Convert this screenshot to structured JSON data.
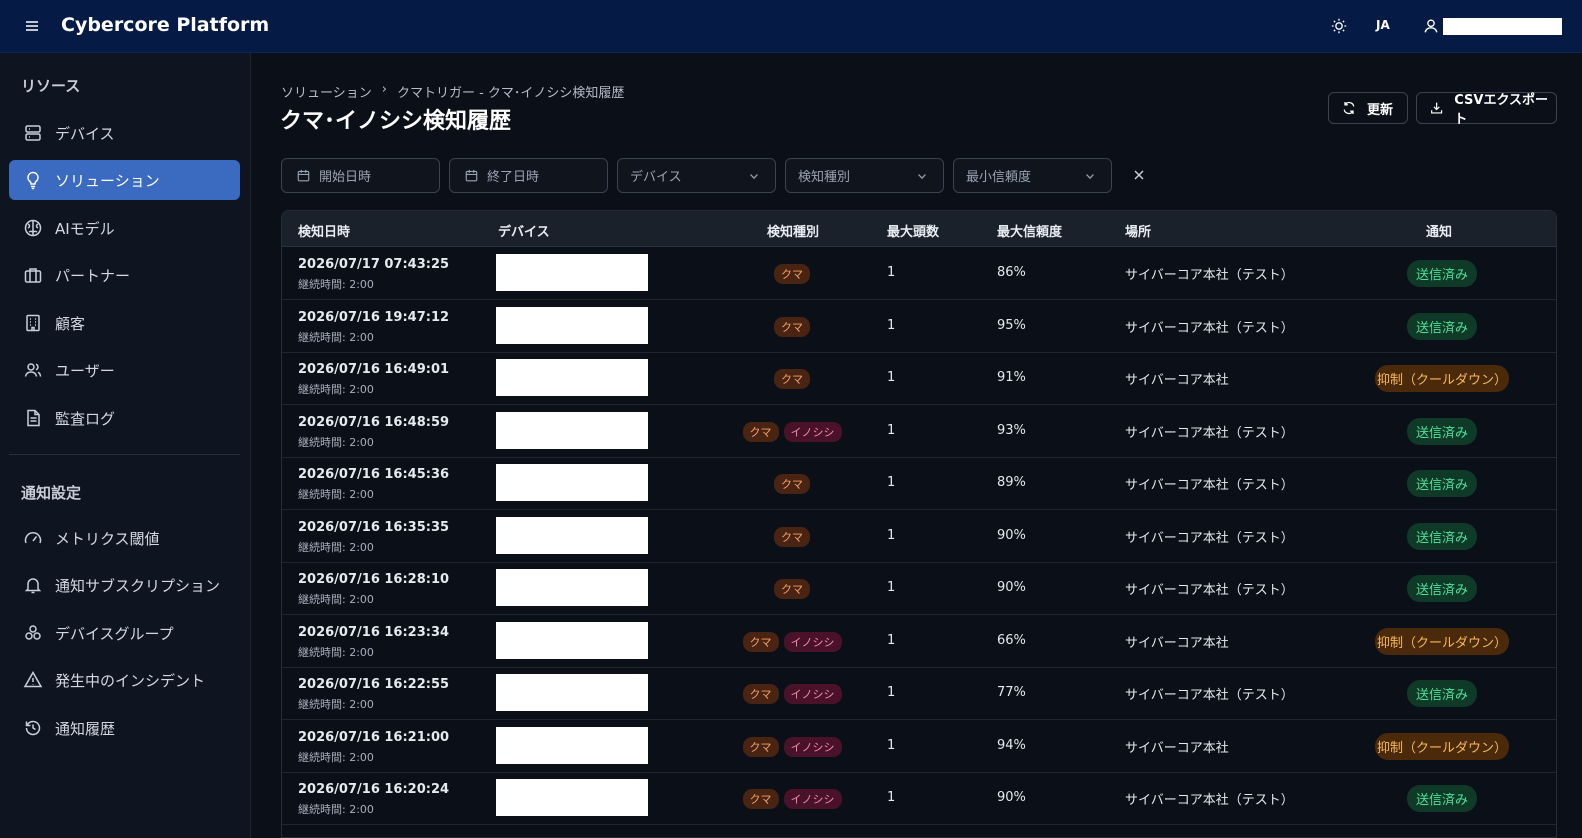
{
  "header": {
    "app_title": "Cybercore Platform",
    "language": "JA"
  },
  "sidebar": {
    "section_resources": "リソース",
    "resources": [
      {
        "label": "デバイス",
        "icon": "server-icon"
      },
      {
        "label": "ソリューション",
        "icon": "lightbulb-icon",
        "active": true
      },
      {
        "label": "AIモデル",
        "icon": "brain-icon"
      },
      {
        "label": "パートナー",
        "icon": "briefcase-icon"
      },
      {
        "label": "顧客",
        "icon": "building-icon"
      },
      {
        "label": "ユーザー",
        "icon": "users-icon"
      },
      {
        "label": "監査ログ",
        "icon": "file-text-icon"
      }
    ],
    "section_notifications": "通知設定",
    "notifications": [
      {
        "label": "メトリクス閾値",
        "icon": "gauge-icon"
      },
      {
        "label": "通知サブスクリプション",
        "icon": "bell-icon"
      },
      {
        "label": "デバイスグループ",
        "icon": "group-icon"
      },
      {
        "label": "発生中のインシデント",
        "icon": "alert-triangle-icon"
      },
      {
        "label": "通知履歴",
        "icon": "history-icon"
      }
    ]
  },
  "breadcrumb": {
    "parent": "ソリューション",
    "separator": "›",
    "current": "クマトリガー - クマ･イノシシ検知履歴"
  },
  "page_title": "クマ･イノシシ検知履歴",
  "actions": {
    "refresh": "更新",
    "csv_export": "CSVエクスポート"
  },
  "filters": {
    "start_date": "開始日時",
    "end_date": "終了日時",
    "device": "デバイス",
    "detection_type": "検知種別",
    "min_confidence": "最小信頼度"
  },
  "table": {
    "columns": {
      "detected_at": "検知日時",
      "device": "デバイス",
      "detection_type": "検知種別",
      "max_count": "最大頭数",
      "max_confidence": "最大信頼度",
      "location": "場所",
      "notification": "通知"
    },
    "duration_label": "継続時間: 2:00",
    "rows": [
      {
        "datetime": "2026/07/17 07:43:25",
        "duration": "継続時間: 2:00",
        "types": [
          "クマ"
        ],
        "count": "1",
        "confidence": "86%",
        "location": "サイバーコア本社（テスト）",
        "notification": "送信済み",
        "status": "sent"
      },
      {
        "datetime": "2026/07/16 19:47:12",
        "duration": "継続時間: 2:00",
        "types": [
          "クマ"
        ],
        "count": "1",
        "confidence": "95%",
        "location": "サイバーコア本社（テスト）",
        "notification": "送信済み",
        "status": "sent"
      },
      {
        "datetime": "2026/07/16 16:49:01",
        "duration": "継続時間: 2:00",
        "types": [
          "クマ"
        ],
        "count": "1",
        "confidence": "91%",
        "location": "サイバーコア本社",
        "notification": "抑制（クールダウン）",
        "status": "suppressed"
      },
      {
        "datetime": "2026/07/16 16:48:59",
        "duration": "継続時間: 2:00",
        "types": [
          "クマ",
          "イノシシ"
        ],
        "count": "1",
        "confidence": "93%",
        "location": "サイバーコア本社（テスト）",
        "notification": "送信済み",
        "status": "sent"
      },
      {
        "datetime": "2026/07/16 16:45:36",
        "duration": "継続時間: 2:00",
        "types": [
          "クマ"
        ],
        "count": "1",
        "confidence": "89%",
        "location": "サイバーコア本社（テスト）",
        "notification": "送信済み",
        "status": "sent"
      },
      {
        "datetime": "2026/07/16 16:35:35",
        "duration": "継続時間: 2:00",
        "types": [
          "クマ"
        ],
        "count": "1",
        "confidence": "90%",
        "location": "サイバーコア本社（テスト）",
        "notification": "送信済み",
        "status": "sent"
      },
      {
        "datetime": "2026/07/16 16:28:10",
        "duration": "継続時間: 2:00",
        "types": [
          "クマ"
        ],
        "count": "1",
        "confidence": "90%",
        "location": "サイバーコア本社（テスト）",
        "notification": "送信済み",
        "status": "sent"
      },
      {
        "datetime": "2026/07/16 16:23:34",
        "duration": "継続時間: 2:00",
        "types": [
          "クマ",
          "イノシシ"
        ],
        "count": "1",
        "confidence": "66%",
        "location": "サイバーコア本社",
        "notification": "抑制（クールダウン）",
        "status": "suppressed"
      },
      {
        "datetime": "2026/07/16 16:22:55",
        "duration": "継続時間: 2:00",
        "types": [
          "クマ",
          "イノシシ"
        ],
        "count": "1",
        "confidence": "77%",
        "location": "サイバーコア本社（テスト）",
        "notification": "送信済み",
        "status": "sent"
      },
      {
        "datetime": "2026/07/16 16:21:00",
        "duration": "継続時間: 2:00",
        "types": [
          "クマ",
          "イノシシ"
        ],
        "count": "1",
        "confidence": "94%",
        "location": "サイバーコア本社",
        "notification": "抑制（クールダウン）",
        "status": "suppressed"
      },
      {
        "datetime": "2026/07/16 16:20:24",
        "duration": "継続時間: 2:00",
        "types": [
          "クマ",
          "イノシシ"
        ],
        "count": "1",
        "confidence": "90%",
        "location": "サイバーコア本社（テスト）",
        "notification": "送信済み",
        "status": "sent"
      }
    ]
  },
  "colors": {
    "topbar": "#051a45",
    "accent": "#3a6bc0",
    "sent": "#4fe09a",
    "suppressed": "#f7b955"
  }
}
